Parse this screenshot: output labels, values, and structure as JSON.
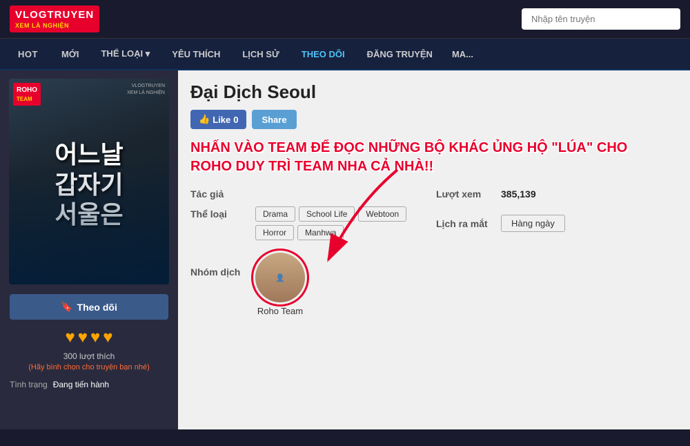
{
  "header": {
    "logo_main": "VLOGTRUYEN",
    "logo_sub": "XEM LÀ NGHIỆN",
    "search_placeholder": "Nhập tên truyện"
  },
  "nav": {
    "items": [
      {
        "label": "HOT",
        "active": false
      },
      {
        "label": "MỚI",
        "active": false
      },
      {
        "label": "THỂ LOẠI ▾",
        "active": false
      },
      {
        "label": "YÊU THÍCH",
        "active": false
      },
      {
        "label": "LỊCH SỬ",
        "active": false
      },
      {
        "label": "THEO DÕI",
        "active": true
      },
      {
        "label": "ĐĂNG TRUYỆN",
        "active": false
      },
      {
        "label": "MAI",
        "active": false
      }
    ]
  },
  "manga": {
    "title": "Đại Dịch Seoul",
    "like_count": "0",
    "like_label": "Like",
    "share_label": "Share",
    "promo_text": "NHẤN VÀO TEAM ĐỂ ĐỌC NHỮNG BỘ KHÁC ỦNG HỘ \"LÚA\" CHO ROHO DUY TRÌ TEAM NHA CẢ NHÀ!!",
    "author_label": "Tác giả",
    "author_value": "",
    "genre_label": "Thể loại",
    "tags": [
      "Drama",
      "School Life",
      "Webtoon",
      "Horror",
      "Manhwa"
    ],
    "translator_label": "Nhóm dịch",
    "translator_name": "Roho Team",
    "views_label": "Lượt xem",
    "views_value": "385,139",
    "release_label": "Lịch ra mắt",
    "release_value": "Hàng ngày",
    "follow_label": "Theo dõi",
    "stars": [
      "♥",
      "♥",
      "♥",
      "♥"
    ],
    "likes_count": "300 lượt thích",
    "vote_prompt": "(Hãy bình chọn cho truyện bạn nhé)",
    "status_label": "Tình trạng",
    "status_value": "Đang tiến hành",
    "cover_korean": "어느날\n갑자기\n서울은",
    "watermark": "VLOGTRUYEN\nXEM LÀ NGHIỆN"
  }
}
